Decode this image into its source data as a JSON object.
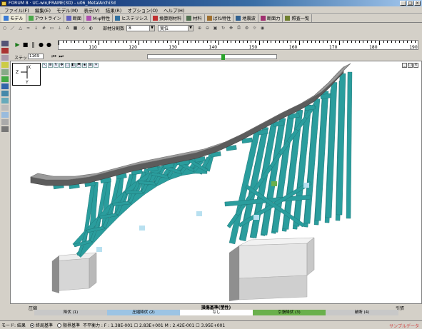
{
  "window": {
    "title": "FORUM 8 · UC-win/FRAME(3D) - u06_MetalArchi3d",
    "controls": [
      "_",
      "□",
      "×"
    ]
  },
  "menu": [
    "ファイル(F)",
    "編集(E)",
    "モデル(M)",
    "表示(V)",
    "結果(R)",
    "オプション(O)",
    "ヘルプ(H)"
  ],
  "tabs": [
    {
      "label": "モデル",
      "icon": "model-icon",
      "color": "#3a7bd5"
    },
    {
      "label": "アウトライン",
      "icon": "outline-icon",
      "color": "#4aa84a"
    },
    {
      "label": "断面",
      "icon": "section-icon",
      "color": "#6060c0"
    },
    {
      "label": "M-φ特性",
      "icon": "m-phi-icon",
      "color": "#b050b0"
    },
    {
      "label": "ヒステリシス",
      "icon": "hysteresis-icon",
      "color": "#3070a0"
    },
    {
      "label": "換算剛材料",
      "icon": "material-icon",
      "color": "#c03030"
    },
    {
      "label": "材料",
      "icon": "material2-icon",
      "color": "#507050"
    },
    {
      "label": "ばね特性",
      "icon": "spring-icon",
      "color": "#a07030"
    },
    {
      "label": "地震波",
      "icon": "wave-icon",
      "color": "#306090"
    },
    {
      "label": "断面力",
      "icon": "force-icon",
      "color": "#a03070"
    },
    {
      "label": "照査一覧",
      "icon": "check-icon",
      "color": "#708030"
    }
  ],
  "toolbar2": {
    "division_label": "部材分割数",
    "division_value": "8",
    "display_value": "実位"
  },
  "player": {
    "ruler_labels": [
      "110",
      "120",
      "130",
      "140",
      "150",
      "160",
      "170",
      "180",
      "190"
    ],
    "step_label": "ステップ",
    "step_value": "1169",
    "slider_position": 0.57
  },
  "axes": {
    "z": "Z",
    "x": "X",
    "y": "Y"
  },
  "legend": {
    "title": "損傷基準(塑性)",
    "left_end": "圧縮",
    "right_end": "引張",
    "segments": [
      {
        "label": "降伏 (1)",
        "color": "#c8c8c8"
      },
      {
        "label": "圧縮降伏 (2)",
        "color": "#9cc4e4"
      },
      {
        "label": "なし",
        "color": "#ffffff"
      },
      {
        "label": "引張降伏 (3)",
        "color": "#6ab04c"
      },
      {
        "label": "破断 (4)",
        "color": "#c8c8c8"
      }
    ]
  },
  "status": {
    "mode": "モード: 結果",
    "radio1": "終局基準",
    "radio2": "限界基準",
    "values": "不平衡力 : F : 1.38E-001 ☐ 2.83E+001 M : 2.42E-001 ☐ 3.95E+001",
    "right": "サンプルデータ"
  },
  "colors": {
    "member": "#2a9d9d",
    "member_dark": "#1d6f70",
    "deck_top": "#8a8a8a",
    "deck_side": "#5a5a5a",
    "pier": "#d9d9d9",
    "yield_compress": "#b8e0f0",
    "yield_tension": "#6ab04c"
  }
}
